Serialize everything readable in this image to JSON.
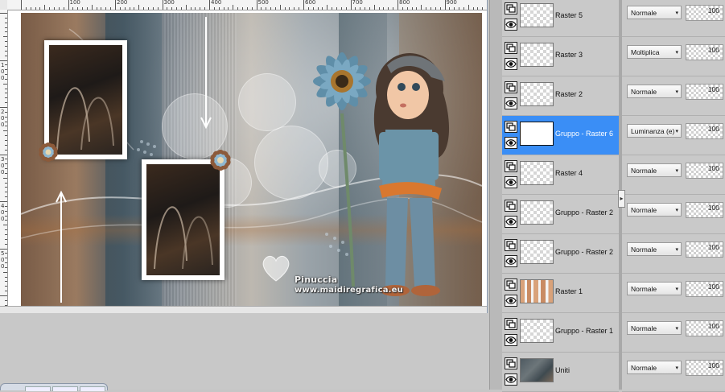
{
  "ruler": {
    "h_labels": [
      "100",
      "200",
      "300",
      "400",
      "500",
      "600",
      "700",
      "800",
      "900"
    ],
    "v_labels": [
      "100",
      "200",
      "300",
      "400",
      "500"
    ]
  },
  "artwork": {
    "watermark_line1": "Pinuccia",
    "watermark_line2": "www.maidiregrafica.eu"
  },
  "layers": [
    {
      "name": "Raster 5",
      "blend": "Normale",
      "opacity": "100",
      "thumb": "blank",
      "selected": false
    },
    {
      "name": "Raster 3",
      "blend": "Moltiplica",
      "opacity": "100",
      "thumb": "blank",
      "selected": false
    },
    {
      "name": "Raster 2",
      "blend": "Normale",
      "opacity": "100",
      "thumb": "blank",
      "selected": false
    },
    {
      "name": "Gruppo - Raster 6",
      "blend": "Luminanza (e)",
      "opacity": "100",
      "thumb": "white",
      "selected": true
    },
    {
      "name": "Raster 4",
      "blend": "Normale",
      "opacity": "100",
      "thumb": "blank",
      "selected": false
    },
    {
      "name": "Gruppo - Raster 2",
      "blend": "Normale",
      "opacity": "100",
      "thumb": "blank",
      "selected": false
    },
    {
      "name": "Gruppo - Raster 2",
      "blend": "Normale",
      "opacity": "100",
      "thumb": "blank",
      "selected": false
    },
    {
      "name": "Raster 1",
      "blend": "Normale",
      "opacity": "100",
      "thumb": "raster1",
      "selected": false
    },
    {
      "name": "Gruppo - Raster 1",
      "blend": "Normale",
      "opacity": "100",
      "thumb": "blank",
      "selected": false
    },
    {
      "name": "Uniti",
      "blend": "Normale",
      "opacity": "100",
      "thumb": "uniti",
      "selected": false
    }
  ],
  "colors": {
    "selected_row": "#3a8ef6",
    "panel_bg": "#c9c9c9"
  }
}
